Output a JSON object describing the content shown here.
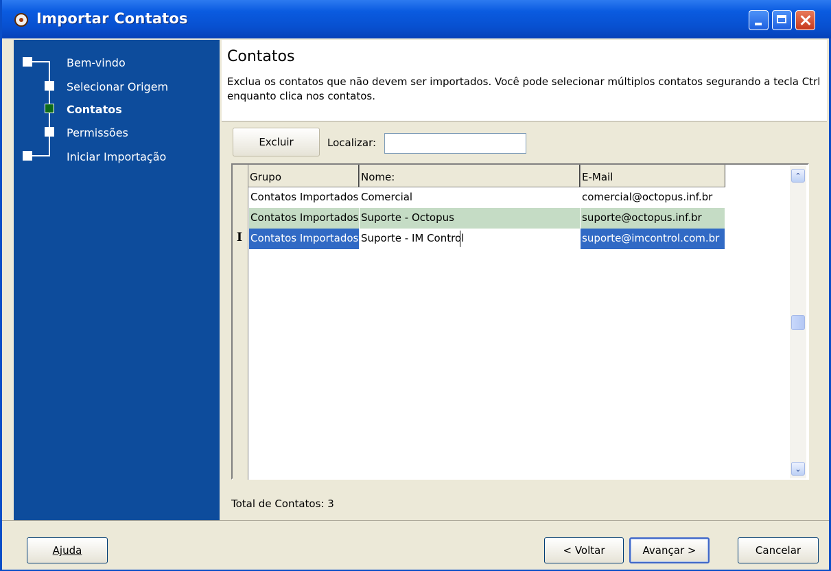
{
  "window": {
    "title": "Importar Contatos"
  },
  "wizard": {
    "steps": [
      {
        "label": "Bem-vindo"
      },
      {
        "label": "Selecionar Origem"
      },
      {
        "label": "Contatos",
        "active": true
      },
      {
        "label": "Permissões"
      },
      {
        "label": "Iniciar Importação"
      }
    ]
  },
  "page": {
    "title": "Contatos",
    "description": "Exclua os contatos que não devem ser importados. Você pode selecionar múltiplos contatos segurando a tecla Ctrl enquanto clica nos contatos."
  },
  "toolbar": {
    "delete_label": "Excluir",
    "search_label": "Localizar:",
    "search_value": ""
  },
  "grid": {
    "columns": [
      "Grupo",
      "Nome:",
      "E-Mail"
    ],
    "rows": [
      {
        "grupo": "Contatos Importados",
        "nome": "Comercial",
        "email": "comercial@octopus.inf.br",
        "state": "normal"
      },
      {
        "grupo": "Contatos Importados",
        "nome": "Suporte - Octopus",
        "email": "suporte@octopus.inf.br",
        "state": "highlight"
      },
      {
        "grupo": "Contatos Importados",
        "nome": "Suporte - IM Control",
        "email": "suporte@imcontrol.com.br",
        "state": "selected"
      }
    ],
    "row_cursor_glyph": "I",
    "scroll_up_glyph": "⌃",
    "scroll_down_glyph": "⌄"
  },
  "status": {
    "total_label": "Total de Contatos:",
    "total_count": "3"
  },
  "footer": {
    "help_label": "Ajuda",
    "back_label": "< Voltar",
    "next_label": "Avançar >",
    "cancel_label": "Cancelar"
  },
  "colors": {
    "sidebar_bg": "#0d4c9c",
    "highlight_row": "#c5dcc5",
    "selected_row": "#316ac5"
  }
}
